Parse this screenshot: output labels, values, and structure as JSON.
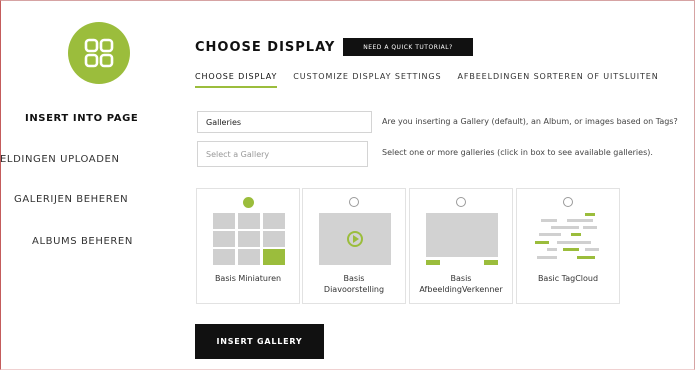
{
  "colors": {
    "accent": "#9bbd3c",
    "dark": "#111111",
    "border": "#d4d4d4"
  },
  "logo": {
    "icon": "grid-icon"
  },
  "sidebar": {
    "items": [
      {
        "label": "INSERT INTO PAGE",
        "active": true
      },
      {
        "label": "ELDINGEN UPLOADEN",
        "active": false
      },
      {
        "label": "GALERIJEN BEHEREN",
        "active": false
      },
      {
        "label": "ALBUMS BEHEREN",
        "active": false
      }
    ]
  },
  "header": {
    "title": "CHOOSE DISPLAY",
    "tutorial_label": "NEED A QUICK TUTORIAL?"
  },
  "tabs": [
    {
      "label": "CHOOSE DISPLAY",
      "active": true
    },
    {
      "label": "CUSTOMIZE DISPLAY SETTINGS",
      "active": false
    },
    {
      "label": "AFBEELDINGEN SORTEREN OF UITSLUITEN",
      "active": false
    }
  ],
  "form": {
    "source": {
      "value": "Galleries",
      "hint": "Are you inserting a Gallery (default), an Album, or images based on Tags?"
    },
    "gallery": {
      "placeholder": "Select a Gallery",
      "hint": "Select one or more galleries (click in box to see available galleries)."
    }
  },
  "display_types": [
    {
      "label_line1": "Basis Miniaturen",
      "label_line2": "",
      "selected": true,
      "icon": "thumbnails-icon"
    },
    {
      "label_line1": "Basis",
      "label_line2": "Diavoorstelling",
      "selected": false,
      "icon": "slideshow-icon"
    },
    {
      "label_line1": "Basis",
      "label_line2": "AfbeeldingVerkenner",
      "selected": false,
      "icon": "imagebrowser-icon"
    },
    {
      "label_line1": "Basic TagCloud",
      "label_line2": "",
      "selected": false,
      "icon": "tagcloud-icon"
    }
  ],
  "footer": {
    "insert_label": "INSERT GALLERY"
  }
}
